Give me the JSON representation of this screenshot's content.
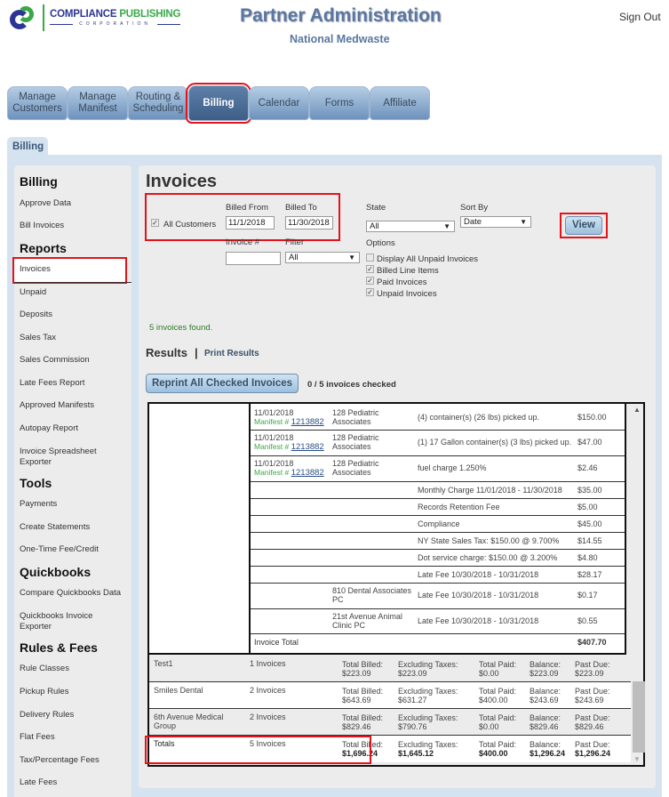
{
  "header": {
    "logo_brand_1": "COMPLIANCE",
    "logo_brand_2": "PUBLISHING",
    "logo_sub": "CORPORATION",
    "title": "Partner Administration",
    "subtitle": "National Medwaste",
    "sign_out": "Sign Out"
  },
  "nav": {
    "tabs": [
      {
        "label": "Manage Customers"
      },
      {
        "label": "Manage Manifest"
      },
      {
        "label": "Routing & Scheduling"
      },
      {
        "label": "Billing",
        "active": true
      },
      {
        "label": "Calendar"
      },
      {
        "label": "Forms"
      },
      {
        "label": "Affiliate"
      }
    ],
    "subtab": "Billing"
  },
  "sidebar": {
    "sections": [
      {
        "heading": "Billing",
        "items": [
          "Approve Data",
          "Bill Invoices"
        ]
      },
      {
        "heading": "Reports",
        "items": [
          "Invoices",
          "Unpaid",
          "Deposits",
          "Sales Tax",
          "Sales Commission",
          "Late Fees Report",
          "Approved Manifests",
          "Autopay Report",
          "Invoice Spreadsheet Exporter"
        ]
      },
      {
        "heading": "Tools",
        "items": [
          "Payments",
          "Create Statements",
          "One-Time Fee/Credit"
        ]
      },
      {
        "heading": "Quickbooks",
        "items": [
          "Compare Quickbooks Data",
          "Quickbooks Invoice Exporter"
        ]
      },
      {
        "heading": "Rules & Fees",
        "items": [
          "Rule Classes",
          "Pickup Rules",
          "Delivery Rules",
          "Flat Fees",
          "Tax/Percentage Fees",
          "Late Fees"
        ]
      }
    ],
    "active_item": "Invoices"
  },
  "filters": {
    "page_title": "Invoices",
    "all_customers_label": "All Customers",
    "all_customers_checked": true,
    "billed_from_label": "Billed From",
    "billed_from_value": "11/1/2018",
    "billed_to_label": "Billed To",
    "billed_to_value": "11/30/2018",
    "invoice_num_label": "Invoice #",
    "invoice_num_value": "",
    "filter_label": "Filter",
    "filter_value": "All",
    "state_label": "State",
    "state_value": "All",
    "sort_by_label": "Sort By",
    "sort_by_value": "Date",
    "options_label": "Options",
    "options": [
      {
        "label": "Display All Unpaid Invoices",
        "checked": false
      },
      {
        "label": "Billed Line Items",
        "checked": true
      },
      {
        "label": "Paid Invoices",
        "checked": true
      },
      {
        "label": "Unpaid Invoices",
        "checked": true
      }
    ],
    "view_button": "View"
  },
  "results": {
    "found_text": "5 invoices found.",
    "heading": "Results",
    "separator": "|",
    "print_link": "Print Results",
    "reprint_button": "Reprint All Checked Invoices",
    "checked_status": "0 / 5 invoices checked",
    "line_items": [
      {
        "date": "11/01/2018",
        "manifest_label": "Manifest #",
        "manifest": "1213882",
        "customer": "128 Pediatric Associates",
        "description": "(4) container(s) (26 lbs) picked up.",
        "amount": "$150.00"
      },
      {
        "date": "11/01/2018",
        "manifest_label": "Manifest #",
        "manifest": "1213882",
        "customer": "128 Pediatric Associates",
        "description": "(1) 17 Gallon container(s) (3 lbs) picked up.",
        "amount": "$47.00"
      },
      {
        "date": "11/01/2018",
        "manifest_label": "Manifest #",
        "manifest": "1213882",
        "customer": "128 Pediatric Associates",
        "description": "fuel charge 1.250%",
        "amount": "$2.46"
      },
      {
        "date": "",
        "customer": "",
        "description": "Monthly Charge 11/01/2018 - 11/30/2018",
        "amount": "$35.00"
      },
      {
        "date": "",
        "customer": "",
        "description": "Records Retention Fee",
        "amount": "$5.00"
      },
      {
        "date": "",
        "customer": "",
        "description": "Compliance",
        "amount": "$45.00"
      },
      {
        "date": "",
        "customer": "",
        "description": "NY State Sales Tax: $150.00 @ 9.700%",
        "amount": "$14.55"
      },
      {
        "date": "",
        "customer": "",
        "description": "Dot service charge: $150.00 @ 3.200%",
        "amount": "$4.80"
      },
      {
        "date": "",
        "customer": "",
        "description": "Late Fee 10/30/2018 - 10/31/2018",
        "amount": "$28.17"
      },
      {
        "date": "",
        "customer": "810 Dental Associates PC",
        "description": "Late Fee 10/30/2018 - 10/31/2018",
        "amount": "$0.17"
      },
      {
        "date": "",
        "customer": "21st Avenue Animal Clinic PC",
        "description": "Late Fee 10/30/2018 - 10/31/2018",
        "amount": "$0.55"
      }
    ],
    "invoice_total_label": "Invoice Total",
    "invoice_total": "$407.70",
    "summary": [
      {
        "customer": "Test1",
        "invoices": "1 Invoices",
        "total_billed": "$223.09",
        "excl_taxes": "$223.09",
        "total_paid": "$0.00",
        "balance": "$223.09",
        "past_due": "$223.09"
      },
      {
        "customer": "Smiles Dental",
        "invoices": "2 Invoices",
        "total_billed": "$643.69",
        "excl_taxes": "$631.27",
        "total_paid": "$400.00",
        "balance": "$243.69",
        "past_due": "$243.69"
      },
      {
        "customer": "6th Avenue Medical Group",
        "invoices": "2 Invoices",
        "total_billed": "$829.46",
        "excl_taxes": "$790.76",
        "total_paid": "$0.00",
        "balance": "$829.46",
        "past_due": "$829.46"
      }
    ],
    "totals": {
      "label": "Totals",
      "invoices": "5 Invoices",
      "total_billed": "$1,696.24",
      "excl_taxes": "$1,645.12",
      "total_paid": "$400.00",
      "balance": "$1,296.24",
      "past_due": "$1,296.24"
    },
    "labels": {
      "total_billed": "Total Billed:",
      "excl_taxes": "Excluding Taxes:",
      "total_paid": "Total Paid:",
      "balance": "Balance:",
      "past_due": "Past Due:"
    }
  }
}
